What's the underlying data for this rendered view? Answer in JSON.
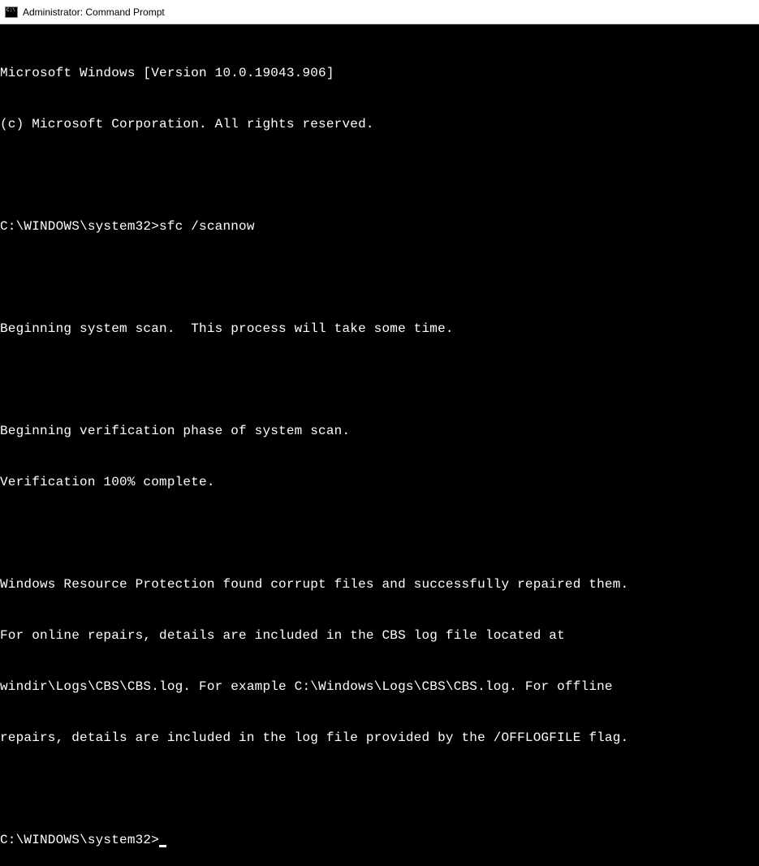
{
  "titlebar": {
    "title": "Administrator: Command Prompt"
  },
  "terminal": {
    "lines": [
      "Microsoft Windows [Version 10.0.19043.906]",
      "(c) Microsoft Corporation. All rights reserved.",
      "",
      "C:\\WINDOWS\\system32>sfc /scannow",
      "",
      "Beginning system scan.  This process will take some time.",
      "",
      "Beginning verification phase of system scan.",
      "Verification 100% complete.",
      "",
      "Windows Resource Protection found corrupt files and successfully repaired them.",
      "For online repairs, details are included in the CBS log file located at",
      "windir\\Logs\\CBS\\CBS.log. For example C:\\Windows\\Logs\\CBS\\CBS.log. For offline",
      "repairs, details are included in the log file provided by the /OFFLOGFILE flag.",
      ""
    ],
    "current_prompt": "C:\\WINDOWS\\system32>"
  }
}
